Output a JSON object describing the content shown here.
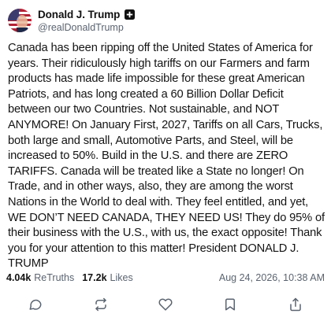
{
  "author": {
    "display_name": "Donald J. Trump",
    "handle": "@realDonaldTrump",
    "avatar_icon": "flag-avatar-icon",
    "badge_icon": "verified-plus-icon"
  },
  "post": {
    "text": "Canada has been ripping off the United States of America for years. Their ridiculously high tariffs on our Farmers and farm products has made life impossible for these great American Patriots, and has long created a 60 Billion Dollar Deficit between our two Countries. Not sustainable, and NOT ANYMORE! On January First, 2027, Tariffs on all Cars, Trucks, both large and small, Automotive Parts, and Steel, will be increased to 50%. Build in the U.S. and there are ZERO TARIFFS. Canada will be treated like a State no longer! On Trade, and in other ways, also, they are among the worst Nations in the World to deal with. They feel entitled, and yet, WE DON’T NEED CANADA, THEY NEED US! They do 95% of their business with the U.S., with us, the exact opposite! Thank you for your attention to this matter! President DONALD J. TRUMP"
  },
  "stats": {
    "retruths_count": "4.04k",
    "retruths_label": "ReTruths",
    "likes_count": "17.2k",
    "likes_label": "Likes",
    "timestamp": "Aug 24, 2026, 10:38 AM"
  },
  "actions": [
    {
      "icon": "reply-icon"
    },
    {
      "icon": "retruth-icon"
    },
    {
      "icon": "heart-icon"
    },
    {
      "icon": "bookmark-icon"
    },
    {
      "icon": "share-icon"
    }
  ],
  "colors": {
    "text": "#141414",
    "muted": "#5b6470",
    "icon": "#5b6470"
  }
}
